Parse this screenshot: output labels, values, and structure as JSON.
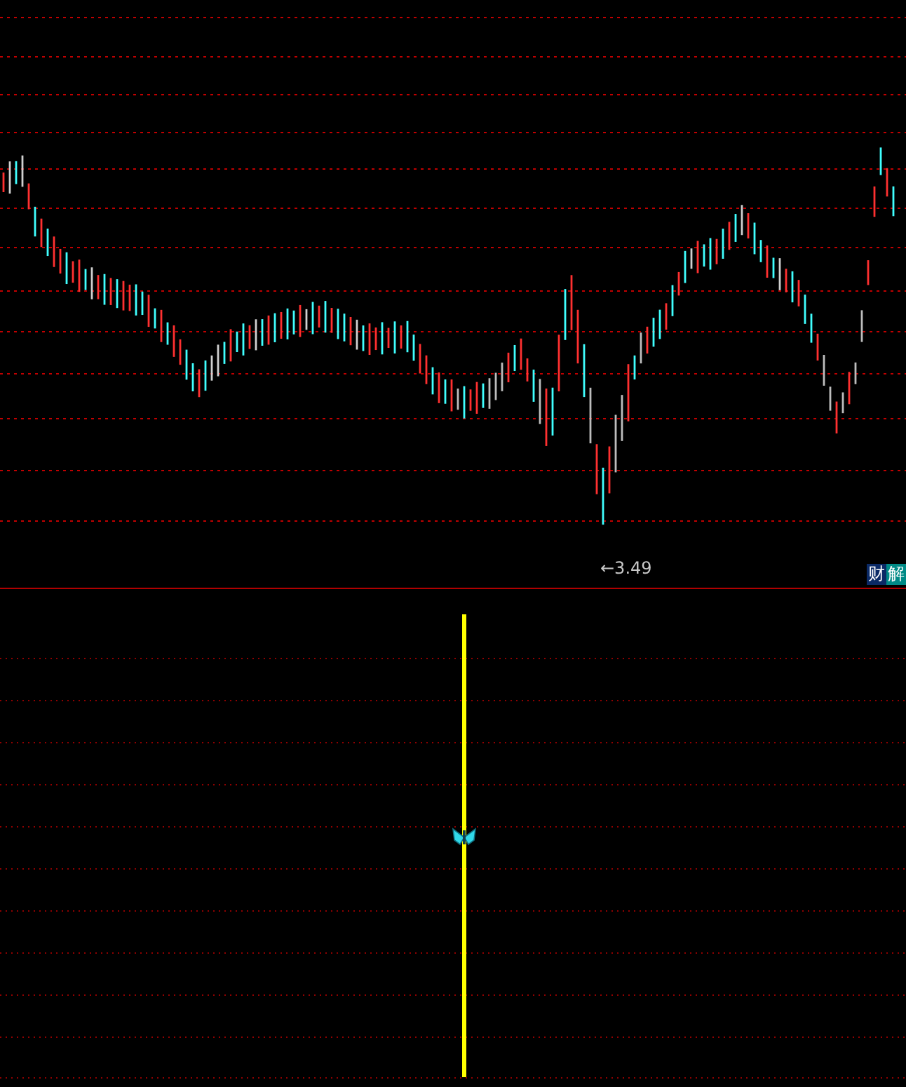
{
  "price_panel": {
    "low_label": "←3.49",
    "badge": [
      {
        "text": "财",
        "color": "#0b2a66"
      },
      {
        "text": "解",
        "color": "#008a86"
      }
    ]
  },
  "indicator_panel": {
    "signal_line": true
  }
}
